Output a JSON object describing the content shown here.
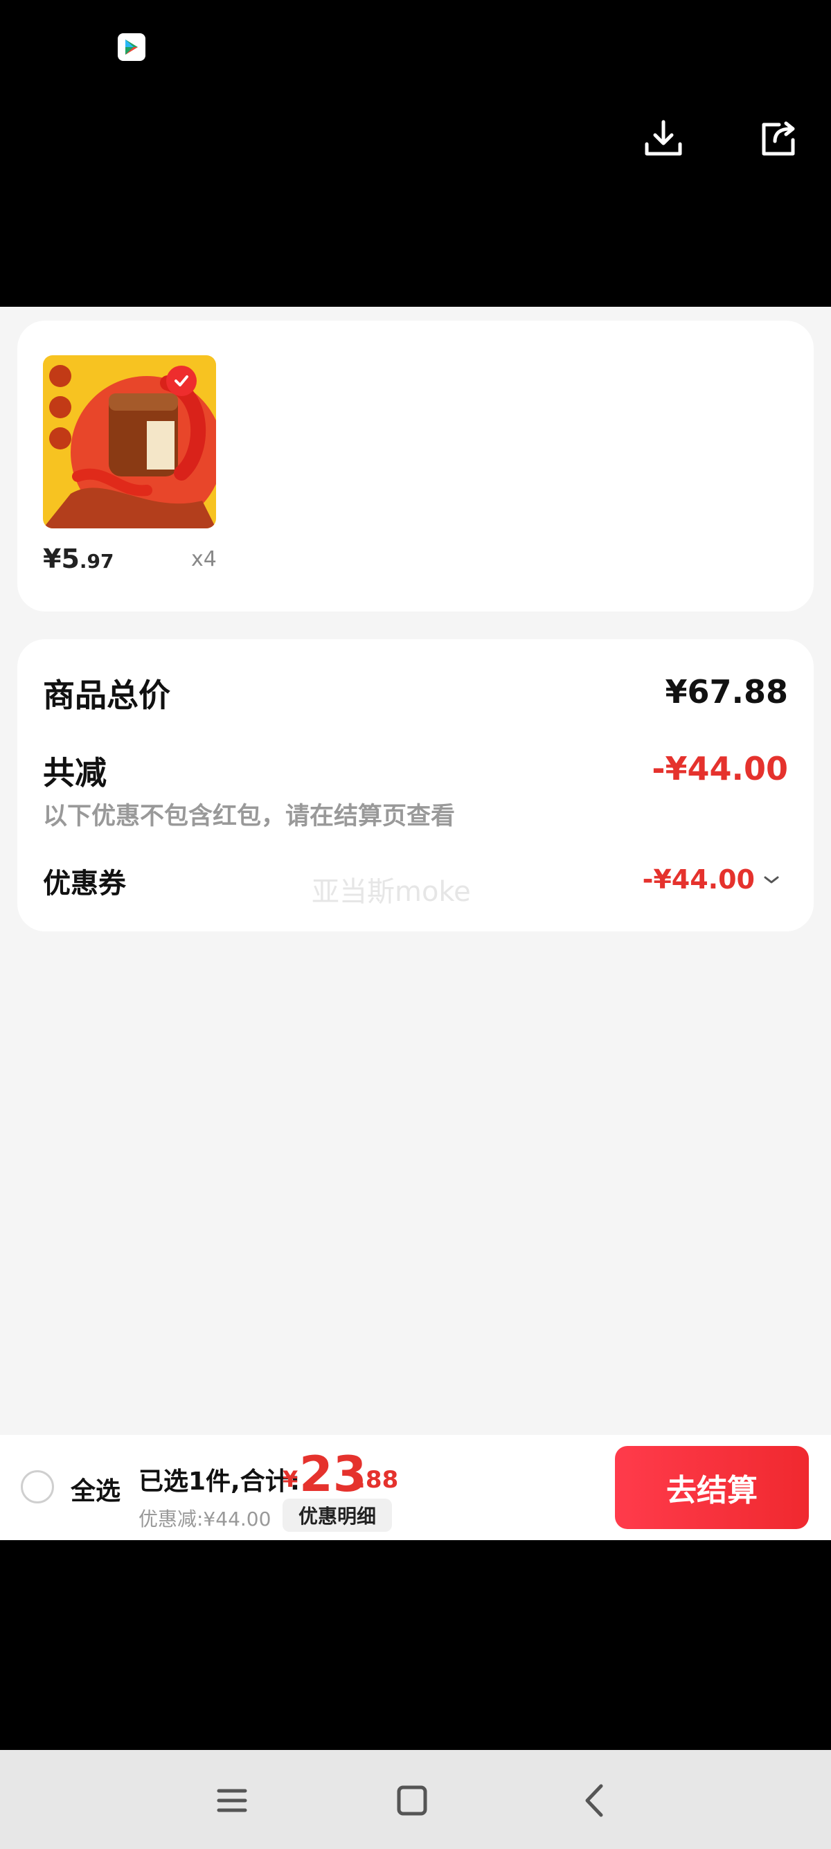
{
  "top": {
    "app_badge_icon": "play-store-icon",
    "download_icon": "download-icon",
    "share_icon": "share-icon"
  },
  "product": {
    "price_prefix": "¥5",
    "price_decimal": ".97",
    "quantity": "x4",
    "image_icon": "product-thumbnail",
    "selected_icon": "check-icon"
  },
  "summary": {
    "total_label": "商品总价",
    "total_value": "¥67.88",
    "reduction_label": "共减",
    "reduction_value": "-¥44.00",
    "note": "以下优惠不包含红包，请在结算页查看",
    "coupon_label": "优惠券",
    "coupon_value": "-¥44.00",
    "coupon_chevron": "chevron-down-icon"
  },
  "watermark": "亚当斯moke",
  "checkout": {
    "select_all": "全选",
    "selected_info": "已选1件,合计:",
    "total_yen": "¥",
    "total_int": "23",
    "total_dec": ".88",
    "discount": "优惠减:¥44.00",
    "detail_button": "优惠明细",
    "checkout_button": "去结算"
  },
  "nav": {
    "menu_icon": "menu-icon",
    "home_icon": "home-square-icon",
    "back_icon": "back-chevron-icon"
  },
  "colors": {
    "accent_red": "#e5322d",
    "button_red": "#f0292f",
    "background": "#f5f5f5"
  }
}
